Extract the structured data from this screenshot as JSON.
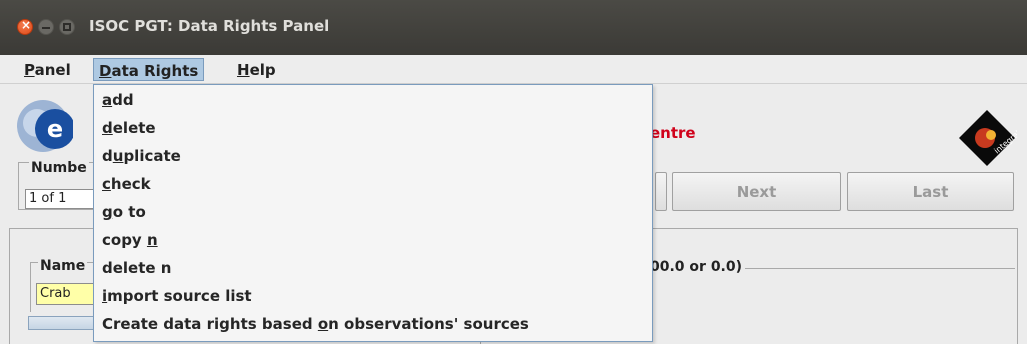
{
  "window": {
    "title": "ISOC PGT: Data Rights Panel"
  },
  "menubar": {
    "items": [
      {
        "pre": "",
        "mn": "P",
        "post": "anel"
      },
      {
        "pre": "",
        "mn": "D",
        "post": "ata Rights"
      },
      {
        "pre": "",
        "mn": "H",
        "post": "elp"
      }
    ]
  },
  "dropdown": {
    "items": [
      {
        "pre": "",
        "mn": "a",
        "post": "dd"
      },
      {
        "pre": "",
        "mn": "d",
        "post": "elete"
      },
      {
        "pre": "d",
        "mn": "u",
        "post": "plicate"
      },
      {
        "pre": "",
        "mn": "c",
        "post": "heck"
      },
      {
        "pre": "",
        "mn": "g",
        "post": "o to"
      },
      {
        "pre": "copy ",
        "mn": "n",
        "post": ""
      },
      {
        "pre": "delete n",
        "mn": "",
        "post": ""
      },
      {
        "pre": "",
        "mn": "i",
        "post": "mport source list"
      },
      {
        "pre": "Create data rights based ",
        "mn": "o",
        "post": "n observations' sources"
      }
    ]
  },
  "header": {
    "centre_text": "entre"
  },
  "navigation": {
    "number_label": "Numbe",
    "record_position": "1 of 1",
    "next_label": "Next",
    "last_label": "Last"
  },
  "details": {
    "name_label": "Name",
    "name_value": "Crab",
    "range_label": "00.0 or 0.0)"
  },
  "colors": {
    "titlebar": "#3f3e3a",
    "menu_highlight": "#aec9e2",
    "brand_red": "#d0021b",
    "name_field_bg": "#ffffa8"
  }
}
